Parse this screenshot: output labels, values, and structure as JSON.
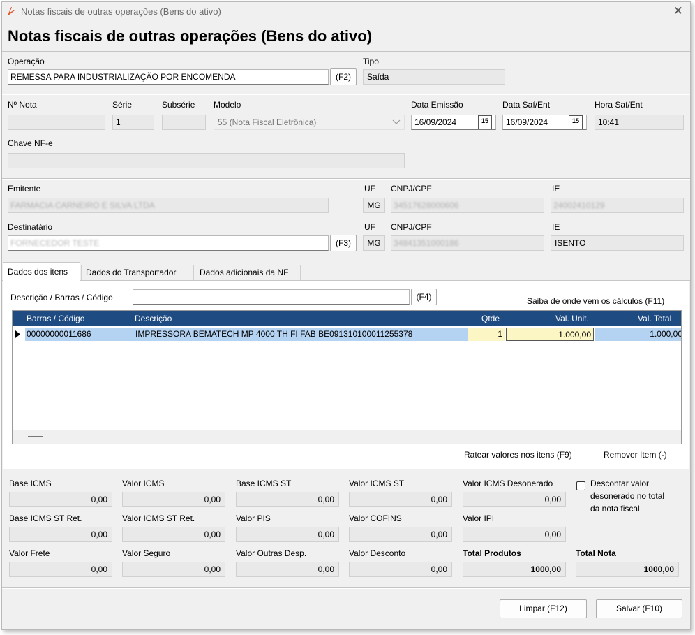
{
  "window": {
    "title": "Notas fiscais de outras operações (Bens do ativo)",
    "heading": "Notas fiscais de outras operações (Bens do ativo)",
    "close": "✕",
    "accent": "#e2572c"
  },
  "operacao": {
    "label": "Operação",
    "value": "REMESSA PARA INDUSTRIALIZAÇÃO POR ENCOMENDA",
    "button": "(F2)",
    "tipo_label": "Tipo",
    "tipo_value": "Saída"
  },
  "nota": {
    "numero_label": "Nº Nota",
    "numero_value": "",
    "serie_label": "Série",
    "serie_value": "1",
    "subserie_label": "Subsérie",
    "subserie_value": "",
    "modelo_label": "Modelo",
    "modelo_value": "55 (Nota Fiscal Eletrônica)",
    "data_emissao_label": "Data Emissão",
    "data_emissao_value": "16/09/2024",
    "data_saient_label": "Data Saí/Ent",
    "data_saient_value": "16/09/2024",
    "hora_label": "Hora Saí/Ent",
    "hora_value": "10:41",
    "calendar_glyph": "15",
    "chave_label": "Chave NF-e",
    "chave_value": ""
  },
  "emitente": {
    "label": "Emitente",
    "value": "FARMACIA CARNEIRO E SILVA LTDA",
    "uf_label": "UF",
    "uf_value": "MG",
    "cnpj_label": "CNPJ/CPF",
    "cnpj_value": "34517628000606",
    "ie_label": "IE",
    "ie_value": "24002410129"
  },
  "destinatario": {
    "label": "Destinatário",
    "value": "FORNECEDOR TESTE",
    "button": "(F3)",
    "uf_label": "UF",
    "uf_value": "MG",
    "cnpj_label": "CNPJ/CPF",
    "cnpj_value": "34841351000186",
    "ie_label": "IE",
    "ie_value": "ISENTO"
  },
  "tabs": [
    {
      "label": "Dados dos itens",
      "active": true
    },
    {
      "label": "Dados do Transportador",
      "active": false
    },
    {
      "label": "Dados adicionais da NF",
      "active": false
    }
  ],
  "itens": {
    "search_label": "Descrição / Barras / Código",
    "search_value": "",
    "search_button": "(F4)",
    "calc_link": "Saiba de onde vem os cálculos (F11)",
    "columns": [
      "Barras / Código",
      "Descrição",
      "Qtde",
      "Val. Unit.",
      "Val. Total"
    ],
    "rows": [
      {
        "codigo": "00000000011686",
        "descricao": "IMPRESSORA BEMATECH MP 4000 TH FI  FAB BE091310100011255378",
        "qtde": "1",
        "val_unit": "1.000,00",
        "val_total": "1.000,00"
      }
    ],
    "ratear": "Ratear valores nos itens (F9)",
    "remover": "Remover Item (-)"
  },
  "totais": {
    "base_icms": {
      "label": "Base ICMS",
      "value": "0,00"
    },
    "valor_icms": {
      "label": "Valor ICMS",
      "value": "0,00"
    },
    "base_icms_st": {
      "label": "Base ICMS ST",
      "value": "0,00"
    },
    "valor_icms_st": {
      "label": "Valor ICMS ST",
      "value": "0,00"
    },
    "valor_icms_desonerado": {
      "label": "Valor ICMS Desonerado",
      "value": "0,00"
    },
    "base_icms_st_ret": {
      "label": "Base ICMS ST Ret.",
      "value": "0,00"
    },
    "valor_icms_st_ret": {
      "label": "Valor ICMS ST Ret.",
      "value": "0,00"
    },
    "valor_pis": {
      "label": "Valor PIS",
      "value": "0,00"
    },
    "valor_cofins": {
      "label": "Valor COFINS",
      "value": "0,00"
    },
    "valor_ipi": {
      "label": "Valor IPI",
      "value": "0,00"
    },
    "valor_frete": {
      "label": "Valor Frete",
      "value": "0,00"
    },
    "valor_seguro": {
      "label": "Valor Seguro",
      "value": "0,00"
    },
    "valor_outras": {
      "label": "Valor Outras Desp.",
      "value": "0,00"
    },
    "valor_desconto": {
      "label": "Valor Desconto",
      "value": "0,00"
    },
    "total_produtos": {
      "label": "Total Produtos",
      "value": "1000,00"
    },
    "total_nota": {
      "label": "Total Nota",
      "value": "1000,00"
    },
    "descontar_label_1": "Descontar valor",
    "descontar_label_2": "desonerado no total",
    "descontar_label_3": "da nota fiscal"
  },
  "footer": {
    "limpar": "Limpar (F12)",
    "salvar": "Salvar (F10)"
  }
}
